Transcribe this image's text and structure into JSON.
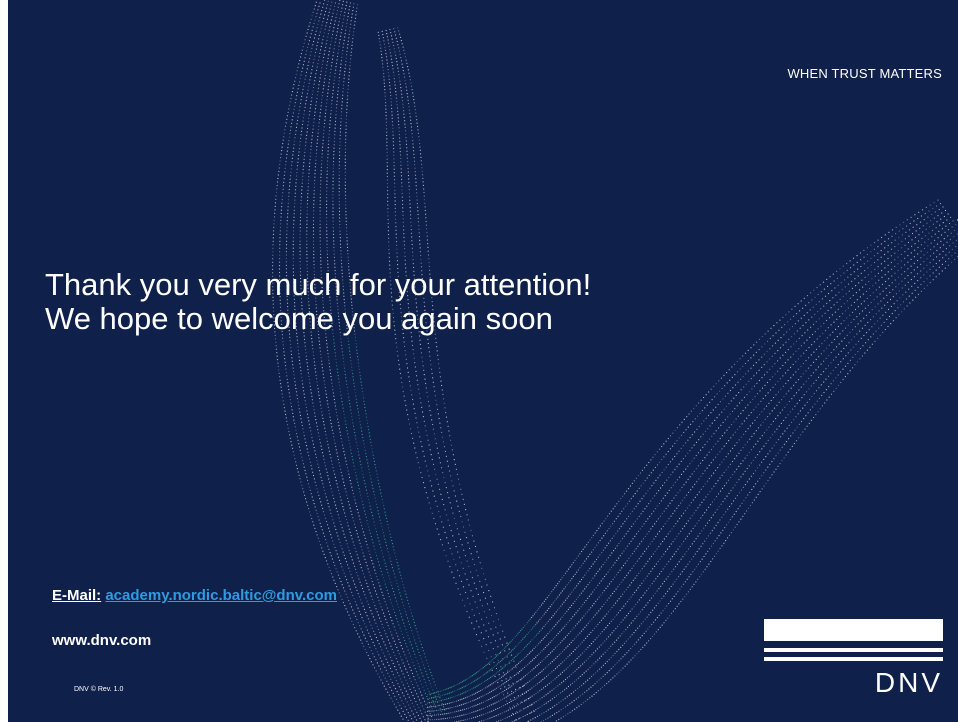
{
  "slide": {
    "tagline": "WHEN TRUST MATTERS",
    "title_line1": "Thank you very much for your attention!",
    "title_line2": "We hope to welcome you again soon",
    "email_label": "E-Mail:",
    "email_address": "academy.nordic.baltic@dnv.com",
    "website": "www.dnv.com",
    "revision": "DNV © Rev. 1.0",
    "logo_text": "DNV"
  },
  "colors": {
    "background": "#0f204b",
    "link": "#2f9be0",
    "dots_green": "#3ddc97",
    "dots_white": "#ffffff"
  }
}
